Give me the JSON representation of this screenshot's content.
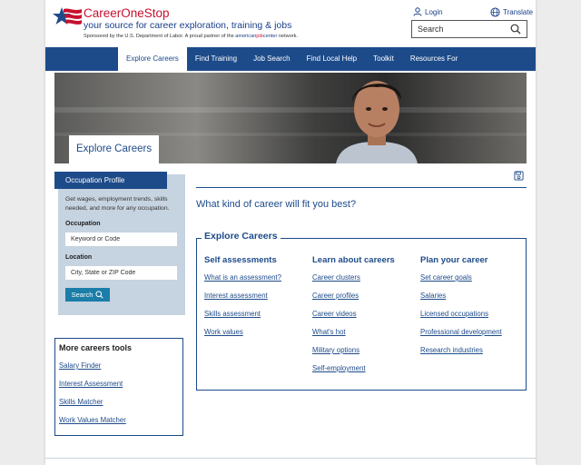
{
  "header": {
    "brand_name": "CareerOneStop",
    "tagline": "your source for career exploration, training & jobs",
    "sponsor_prefix": "Sponsored by the U.S. Department of Labor.  A proud partner of the ",
    "sponsor_ajc_a": "american",
    "sponsor_ajc_b": "job",
    "sponsor_ajc_c": "center",
    "sponsor_suffix": " network.",
    "login_label": "Login",
    "translate_label": "Translate",
    "search_placeholder": "Search"
  },
  "nav": {
    "items": [
      {
        "label": "Explore Careers"
      },
      {
        "label": "Find Training"
      },
      {
        "label": "Job Search"
      },
      {
        "label": "Find Local Help"
      },
      {
        "label": "Toolkit"
      },
      {
        "label": "Resources For"
      }
    ]
  },
  "hero": {
    "label": "Explore Careers"
  },
  "occupation_profile": {
    "tab_label": "Occupation Profile",
    "description": "Get wages, employment trends, skills needed, and more for any occupation.",
    "occupation_label": "Occupation",
    "occupation_placeholder": "Keyword or Code",
    "location_label": "Location",
    "location_placeholder": "City, State or ZIP Code",
    "search_button": "Search"
  },
  "more_tools": {
    "title": "More careers tools",
    "links": [
      "Salary Finder",
      "Interest Assessment",
      "Skills Matcher",
      "Work Values Matcher"
    ]
  },
  "main": {
    "question": "What kind of career will fit you best?",
    "explore_title": "Explore Careers",
    "columns": [
      {
        "heading": "Self assessments",
        "links": [
          "What is an assessment?",
          "Interest assessment",
          "Skills assessment",
          "Work values"
        ]
      },
      {
        "heading": "Learn about careers",
        "links": [
          "Career clusters",
          "Career profiles",
          "Career videos",
          "What's hot",
          "Military options",
          "Self-employment"
        ]
      },
      {
        "heading": "Plan your career",
        "links": [
          "Set career goals",
          "Salaries",
          "Licensed occupations",
          "Professional development",
          "Research industries"
        ]
      }
    ]
  },
  "colors": {
    "navy": "#1d4b8a",
    "red": "#c8102e",
    "sidebar_bg": "#c6d3e0",
    "button": "#1b7ea8"
  },
  "icons": [
    "flag-star-logo-icon",
    "user-icon",
    "globe-icon",
    "search-icon",
    "save-icon"
  ]
}
